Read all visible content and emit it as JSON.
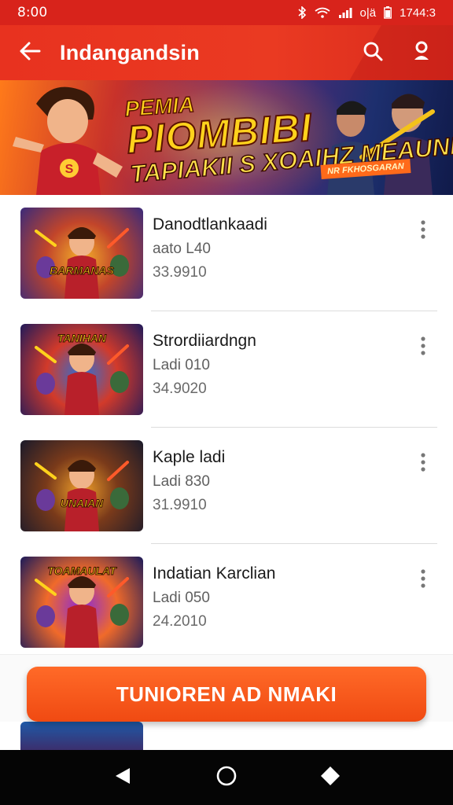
{
  "status_bar": {
    "time": "8:00",
    "battery_text": "o|ä",
    "right_text": "1744:3"
  },
  "app_bar": {
    "title": "Indangandsin"
  },
  "banner": {
    "line1": "PEMIA",
    "line2": "PIOMBIBI",
    "line3": "TAPIAKII S XOAIHZ MEAUNI",
    "ribbon": "NR FKHOSGARAN"
  },
  "items": [
    {
      "title": "Danodtlankaadi",
      "subtitle": "aato L40",
      "price": "33.9910",
      "thumb_label": "BARMANAS",
      "thumb_colors": [
        "#f4b02a",
        "#c2452a",
        "#3a2a7a"
      ]
    },
    {
      "title": "Strordiiardngn",
      "subtitle": "Ladi 010",
      "price": "34.9020",
      "thumb_label": "TANIHAN",
      "thumb_colors": [
        "#2a70d8",
        "#d23a2a",
        "#201a5a"
      ]
    },
    {
      "title": "Kaple ladi",
      "subtitle": "Ladi 830",
      "price": "31.9910",
      "thumb_label": "UNAIAN",
      "thumb_colors": [
        "#f0a02a",
        "#7a3a1a",
        "#1a1a2a"
      ]
    },
    {
      "title": "Indatian Karclian",
      "subtitle": "Ladi 050",
      "price": "24.2010",
      "thumb_label": "TOAMAULAT",
      "thumb_colors": [
        "#8a2ad8",
        "#f06a2a",
        "#1a1a5a"
      ]
    }
  ],
  "cta": {
    "label": "TUNIOREN AD NMAKI"
  },
  "colors": {
    "primary": "#e8321f",
    "cta": "#f25a1a",
    "nav_bg": "#050505"
  }
}
